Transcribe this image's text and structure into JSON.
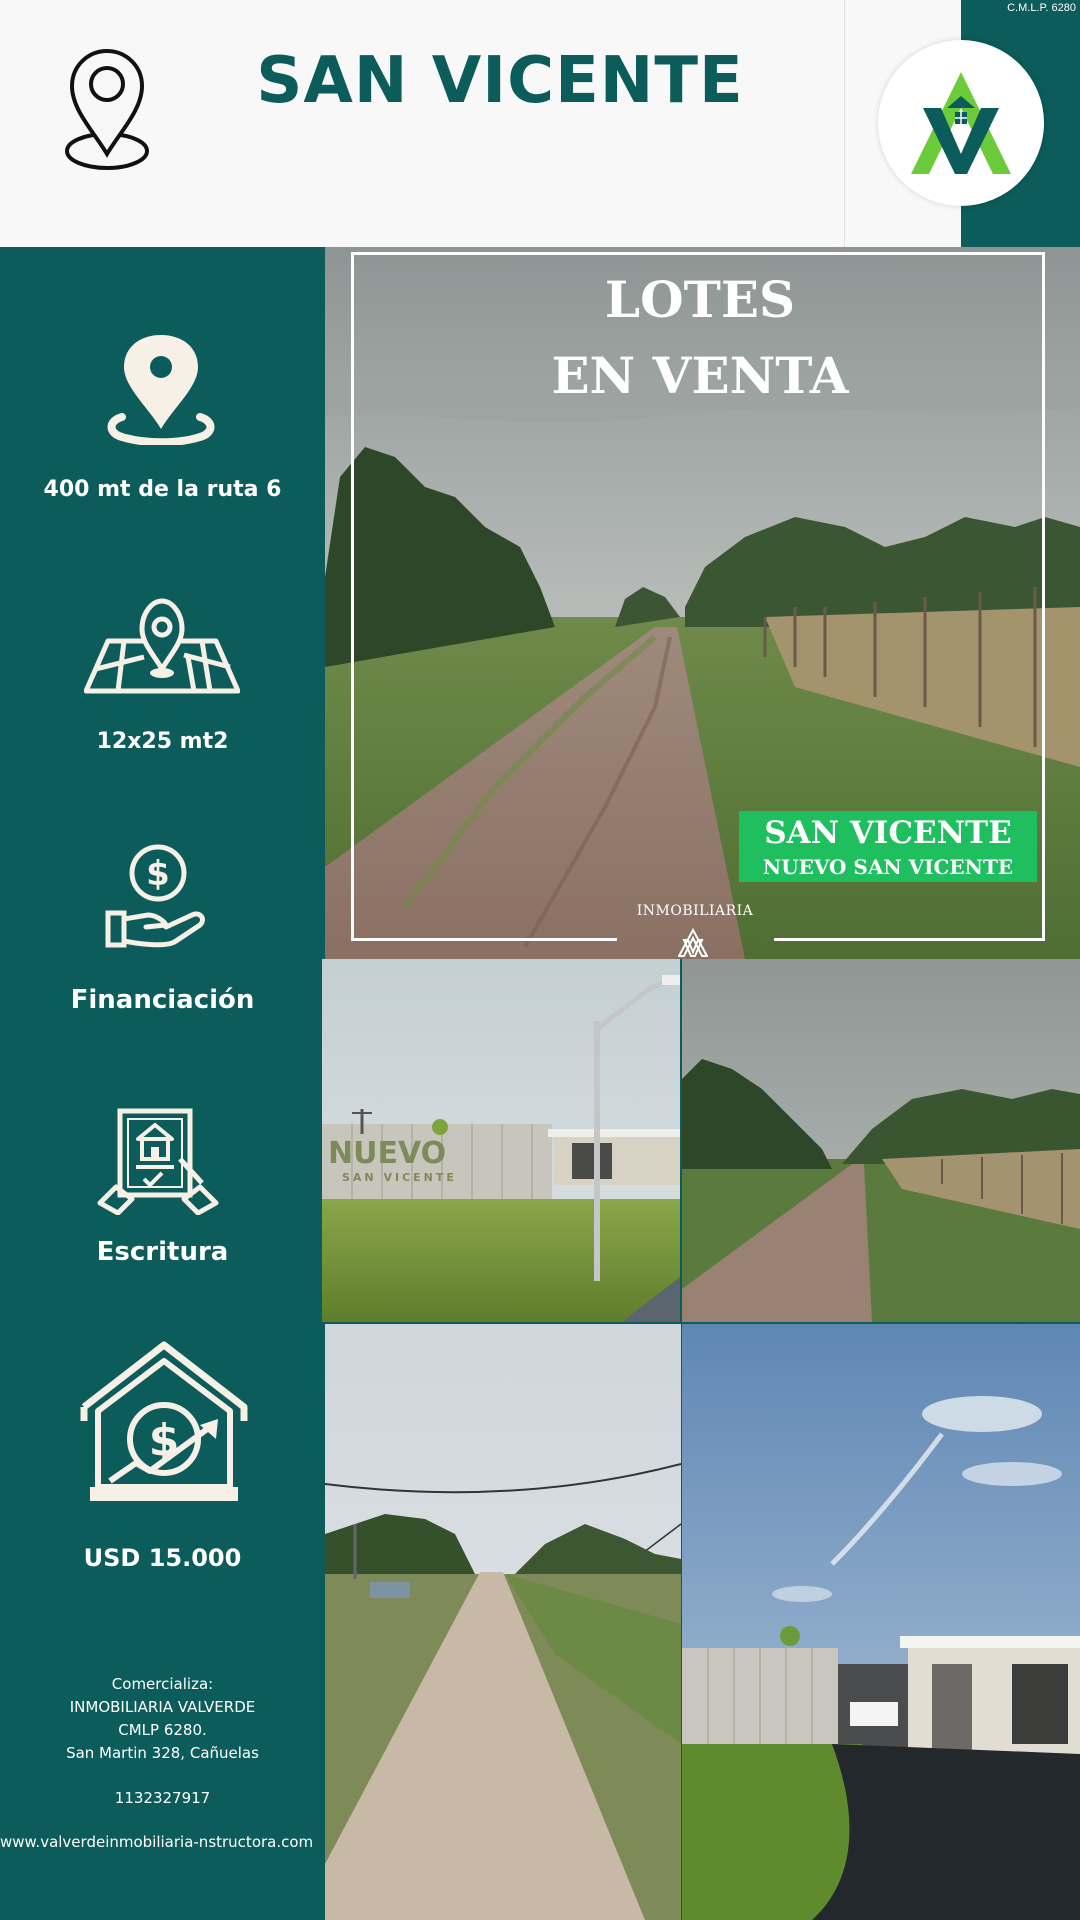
{
  "header": {
    "title": "SAN VICENTE",
    "cmlp": "C.M.L.P. 6280",
    "pin_icon": "location-pin-outline-icon",
    "logo": "valverde-logo"
  },
  "sidebar": {
    "features": [
      {
        "icon": "location-pin-icon",
        "label": "400 mt de la ruta 6"
      },
      {
        "icon": "map-pin-icon",
        "label": "12x25 mt2"
      },
      {
        "icon": "hand-dollar-icon",
        "label": "Financiación"
      },
      {
        "icon": "deed-signing-icon",
        "label": "Escritura"
      },
      {
        "icon": "house-dollar-icon",
        "label": "USD 15.000"
      }
    ],
    "contact": {
      "line1": "Comercializa:",
      "line2": "INMOBILIARIA VALVERDE",
      "line3": "CMLP 6280.",
      "line4": "San Martin 328, Cañuelas",
      "phone": "1132327917"
    },
    "website": "www.valverdeinmobiliaria-nstructora.com"
  },
  "hero": {
    "title_line1": "LOTES",
    "title_line2": "EN VENTA",
    "badge_line1": "SAN VICENTE",
    "badge_line2": "NUEVO SAN VICENTE",
    "footer_label": "INMOBILIARIA"
  },
  "photos": {
    "entrance_sign": "NUEVO",
    "entrance_sign_sub": "SAN VICENTE"
  },
  "colors": {
    "primary": "#0b5c5a",
    "badge_green": "#1fbf5f",
    "logo_green": "#6ccb3a",
    "cream": "#f6f0e6"
  }
}
